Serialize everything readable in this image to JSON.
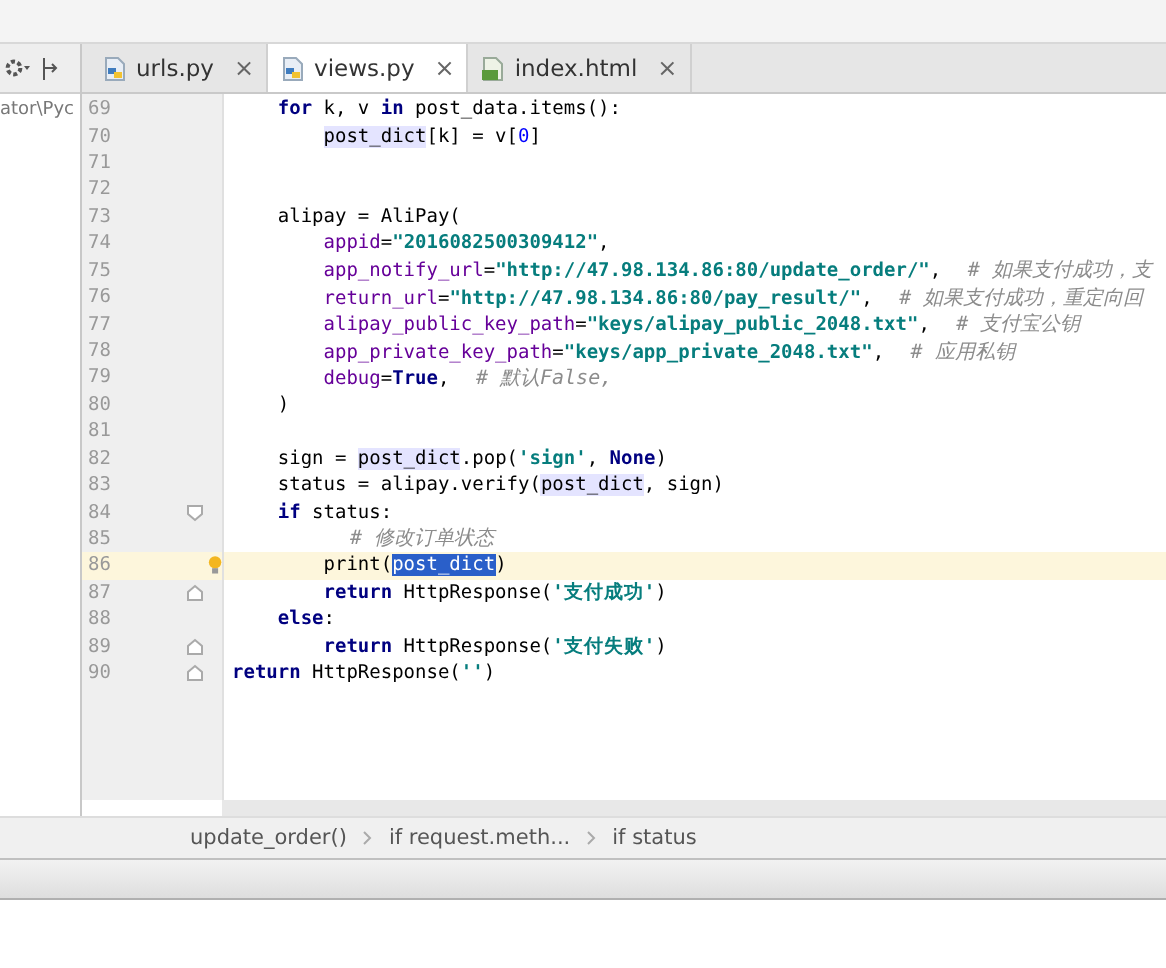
{
  "project_panel": {
    "path": "ator\\Pyc"
  },
  "tabs": [
    {
      "label": "urls.py",
      "kind": "python",
      "selected": false,
      "close": "×"
    },
    {
      "label": "views.py",
      "kind": "python",
      "selected": true,
      "close": "×"
    },
    {
      "label": "index.html",
      "kind": "html",
      "selected": false,
      "close": "×"
    }
  ],
  "lines": [
    {
      "number": "69",
      "kind": "block",
      "current": false,
      "tokens": [
        {
          "kind": "kw",
          "text": "for"
        },
        {
          "kind": "plain",
          "text": " k, v "
        },
        {
          "kind": "kw",
          "text": "in"
        },
        {
          "kind": "plain",
          "text": " post_data.items():"
        }
      ]
    },
    {
      "number": "70",
      "kind": "nested",
      "current": false,
      "tokens": [
        {
          "kind": "usage",
          "text": "post_dict"
        },
        {
          "kind": "plain",
          "text": "[k] = v["
        },
        {
          "kind": "num",
          "text": "0"
        },
        {
          "kind": "plain",
          "text": "]"
        }
      ]
    },
    {
      "number": "71",
      "kind": "top",
      "current": false
    },
    {
      "number": "72",
      "kind": "top",
      "current": false
    },
    {
      "number": "73",
      "kind": "block",
      "current": false,
      "tokens": [
        {
          "kind": "plain",
          "text": "alipay = AliPay("
        }
      ]
    },
    {
      "number": "74",
      "kind": "nested",
      "current": false,
      "tokens": [
        {
          "kind": "param",
          "text": "appid"
        },
        {
          "kind": "plain",
          "text": "="
        },
        {
          "kind": "str",
          "text": "\"2016082500309412\""
        },
        {
          "kind": "plain",
          "text": ","
        }
      ]
    },
    {
      "number": "75",
      "kind": "nested",
      "current": false,
      "tokens": [
        {
          "kind": "param",
          "text": "app_notify_url"
        },
        {
          "kind": "plain",
          "text": "="
        },
        {
          "kind": "str",
          "text": "\"http://47.98.134.86:80/update_order/\""
        },
        {
          "kind": "plain",
          "text": ","
        },
        {
          "kind": "cmt",
          "text": "# 如果支付成功，支"
        }
      ]
    },
    {
      "number": "76",
      "kind": "nested",
      "current": false,
      "tokens": [
        {
          "kind": "param",
          "text": "return_url"
        },
        {
          "kind": "plain",
          "text": "="
        },
        {
          "kind": "str",
          "text": "\"http://47.98.134.86:80/pay_result/\""
        },
        {
          "kind": "plain",
          "text": ","
        },
        {
          "kind": "cmt",
          "text": "# 如果支付成功，重定向回"
        }
      ]
    },
    {
      "number": "77",
      "kind": "nested",
      "current": false,
      "tokens": [
        {
          "kind": "param",
          "text": "alipay_public_key_path"
        },
        {
          "kind": "plain",
          "text": "="
        },
        {
          "kind": "str",
          "text": "\"keys/alipay_public_2048.txt\""
        },
        {
          "kind": "plain",
          "text": ","
        },
        {
          "kind": "cmt",
          "text": "# 支付宝公钥"
        }
      ]
    },
    {
      "number": "78",
      "kind": "nested",
      "current": false,
      "tokens": [
        {
          "kind": "param",
          "text": "app_private_key_path"
        },
        {
          "kind": "plain",
          "text": "="
        },
        {
          "kind": "str",
          "text": "\"keys/app_private_2048.txt\""
        },
        {
          "kind": "plain",
          "text": ","
        },
        {
          "kind": "cmt",
          "text": "# 应用私钥"
        }
      ]
    },
    {
      "number": "79",
      "kind": "nested",
      "current": false,
      "tokens": [
        {
          "kind": "param",
          "text": "debug"
        },
        {
          "kind": "plain",
          "text": "="
        },
        {
          "kind": "kw",
          "text": "True"
        },
        {
          "kind": "plain",
          "text": ","
        },
        {
          "kind": "cmt",
          "text": "# 默认False,"
        }
      ]
    },
    {
      "number": "80",
      "kind": "block",
      "current": false,
      "tokens": [
        {
          "kind": "plain",
          "text": ")"
        }
      ]
    },
    {
      "number": "81",
      "kind": "top",
      "current": false
    },
    {
      "number": "82",
      "kind": "block",
      "current": false,
      "tokens": [
        {
          "kind": "plain",
          "text": "sign = "
        },
        {
          "kind": "usage",
          "text": "post_dict"
        },
        {
          "kind": "plain",
          "text": ".pop("
        },
        {
          "kind": "str",
          "text": "'sign'"
        },
        {
          "kind": "plain",
          "text": ", "
        },
        {
          "kind": "kw",
          "text": "None"
        },
        {
          "kind": "plain",
          "text": ")"
        }
      ]
    },
    {
      "number": "83",
      "kind": "block",
      "current": false,
      "tokens": [
        {
          "kind": "plain",
          "text": "status = alipay.verify("
        },
        {
          "kind": "usage",
          "text": "post_dict"
        },
        {
          "kind": "plain",
          "text": ", sign)"
        }
      ]
    },
    {
      "number": "84",
      "kind": "block",
      "current": false,
      "fold_start": true,
      "tokens": [
        {
          "kind": "kw",
          "text": "if"
        },
        {
          "kind": "plain",
          "text": " status:"
        }
      ]
    },
    {
      "number": "85",
      "kind": "nested",
      "current": false,
      "tokens": [
        {
          "kind": "cmt",
          "text": "# 修改订单状态"
        }
      ]
    },
    {
      "number": "86",
      "kind": "nested",
      "current": true,
      "tokens": [
        {
          "kind": "plain",
          "text": "print("
        },
        {
          "kind": "sel",
          "text": "post_dict"
        },
        {
          "kind": "plain",
          "text": ")"
        }
      ]
    },
    {
      "number": "87",
      "kind": "nested",
      "current": false,
      "fold_end": true,
      "tokens": [
        {
          "kind": "kw",
          "text": "return"
        },
        {
          "kind": "plain",
          "text": " HttpResponse("
        },
        {
          "kind": "str",
          "text": "'支付成功'"
        },
        {
          "kind": "plain",
          "text": ")"
        }
      ]
    },
    {
      "number": "88",
      "kind": "block",
      "current": false,
      "tokens": [
        {
          "kind": "kw",
          "text": "else"
        },
        {
          "kind": "plain",
          "text": ":"
        }
      ]
    },
    {
      "number": "89",
      "kind": "nested",
      "current": false,
      "fold_end": true,
      "tokens": [
        {
          "kind": "kw",
          "text": "return"
        },
        {
          "kind": "plain",
          "text": " HttpResponse("
        },
        {
          "kind": "str",
          "text": "'支付失败'"
        },
        {
          "kind": "plain",
          "text": ")"
        }
      ]
    },
    {
      "number": "90",
      "kind": "top",
      "current": false,
      "fold_end": true,
      "tokens": [
        {
          "kind": "kw",
          "text": "return"
        },
        {
          "kind": "plain",
          "text": " HttpResponse("
        },
        {
          "kind": "str",
          "text": "''"
        },
        {
          "kind": "plain",
          "text": ")"
        }
      ]
    }
  ],
  "breadcrumbs": [
    "update_order()",
    "if request.meth...",
    "if status"
  ]
}
